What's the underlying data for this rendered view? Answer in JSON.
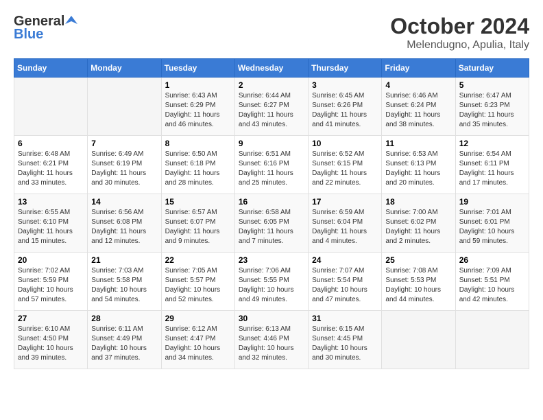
{
  "header": {
    "logo_general": "General",
    "logo_blue": "Blue",
    "month_title": "October 2024",
    "subtitle": "Melendugno, Apulia, Italy"
  },
  "days_of_week": [
    "Sunday",
    "Monday",
    "Tuesday",
    "Wednesday",
    "Thursday",
    "Friday",
    "Saturday"
  ],
  "weeks": [
    [
      {
        "day": "",
        "info": ""
      },
      {
        "day": "",
        "info": ""
      },
      {
        "day": "1",
        "info": "Sunrise: 6:43 AM\nSunset: 6:29 PM\nDaylight: 11 hours and 46 minutes."
      },
      {
        "day": "2",
        "info": "Sunrise: 6:44 AM\nSunset: 6:27 PM\nDaylight: 11 hours and 43 minutes."
      },
      {
        "day": "3",
        "info": "Sunrise: 6:45 AM\nSunset: 6:26 PM\nDaylight: 11 hours and 41 minutes."
      },
      {
        "day": "4",
        "info": "Sunrise: 6:46 AM\nSunset: 6:24 PM\nDaylight: 11 hours and 38 minutes."
      },
      {
        "day": "5",
        "info": "Sunrise: 6:47 AM\nSunset: 6:23 PM\nDaylight: 11 hours and 35 minutes."
      }
    ],
    [
      {
        "day": "6",
        "info": "Sunrise: 6:48 AM\nSunset: 6:21 PM\nDaylight: 11 hours and 33 minutes."
      },
      {
        "day": "7",
        "info": "Sunrise: 6:49 AM\nSunset: 6:19 PM\nDaylight: 11 hours and 30 minutes."
      },
      {
        "day": "8",
        "info": "Sunrise: 6:50 AM\nSunset: 6:18 PM\nDaylight: 11 hours and 28 minutes."
      },
      {
        "day": "9",
        "info": "Sunrise: 6:51 AM\nSunset: 6:16 PM\nDaylight: 11 hours and 25 minutes."
      },
      {
        "day": "10",
        "info": "Sunrise: 6:52 AM\nSunset: 6:15 PM\nDaylight: 11 hours and 22 minutes."
      },
      {
        "day": "11",
        "info": "Sunrise: 6:53 AM\nSunset: 6:13 PM\nDaylight: 11 hours and 20 minutes."
      },
      {
        "day": "12",
        "info": "Sunrise: 6:54 AM\nSunset: 6:11 PM\nDaylight: 11 hours and 17 minutes."
      }
    ],
    [
      {
        "day": "13",
        "info": "Sunrise: 6:55 AM\nSunset: 6:10 PM\nDaylight: 11 hours and 15 minutes."
      },
      {
        "day": "14",
        "info": "Sunrise: 6:56 AM\nSunset: 6:08 PM\nDaylight: 11 hours and 12 minutes."
      },
      {
        "day": "15",
        "info": "Sunrise: 6:57 AM\nSunset: 6:07 PM\nDaylight: 11 hours and 9 minutes."
      },
      {
        "day": "16",
        "info": "Sunrise: 6:58 AM\nSunset: 6:05 PM\nDaylight: 11 hours and 7 minutes."
      },
      {
        "day": "17",
        "info": "Sunrise: 6:59 AM\nSunset: 6:04 PM\nDaylight: 11 hours and 4 minutes."
      },
      {
        "day": "18",
        "info": "Sunrise: 7:00 AM\nSunset: 6:02 PM\nDaylight: 11 hours and 2 minutes."
      },
      {
        "day": "19",
        "info": "Sunrise: 7:01 AM\nSunset: 6:01 PM\nDaylight: 10 hours and 59 minutes."
      }
    ],
    [
      {
        "day": "20",
        "info": "Sunrise: 7:02 AM\nSunset: 5:59 PM\nDaylight: 10 hours and 57 minutes."
      },
      {
        "day": "21",
        "info": "Sunrise: 7:03 AM\nSunset: 5:58 PM\nDaylight: 10 hours and 54 minutes."
      },
      {
        "day": "22",
        "info": "Sunrise: 7:05 AM\nSunset: 5:57 PM\nDaylight: 10 hours and 52 minutes."
      },
      {
        "day": "23",
        "info": "Sunrise: 7:06 AM\nSunset: 5:55 PM\nDaylight: 10 hours and 49 minutes."
      },
      {
        "day": "24",
        "info": "Sunrise: 7:07 AM\nSunset: 5:54 PM\nDaylight: 10 hours and 47 minutes."
      },
      {
        "day": "25",
        "info": "Sunrise: 7:08 AM\nSunset: 5:53 PM\nDaylight: 10 hours and 44 minutes."
      },
      {
        "day": "26",
        "info": "Sunrise: 7:09 AM\nSunset: 5:51 PM\nDaylight: 10 hours and 42 minutes."
      }
    ],
    [
      {
        "day": "27",
        "info": "Sunrise: 6:10 AM\nSunset: 4:50 PM\nDaylight: 10 hours and 39 minutes."
      },
      {
        "day": "28",
        "info": "Sunrise: 6:11 AM\nSunset: 4:49 PM\nDaylight: 10 hours and 37 minutes."
      },
      {
        "day": "29",
        "info": "Sunrise: 6:12 AM\nSunset: 4:47 PM\nDaylight: 10 hours and 34 minutes."
      },
      {
        "day": "30",
        "info": "Sunrise: 6:13 AM\nSunset: 4:46 PM\nDaylight: 10 hours and 32 minutes."
      },
      {
        "day": "31",
        "info": "Sunrise: 6:15 AM\nSunset: 4:45 PM\nDaylight: 10 hours and 30 minutes."
      },
      {
        "day": "",
        "info": ""
      },
      {
        "day": "",
        "info": ""
      }
    ]
  ]
}
